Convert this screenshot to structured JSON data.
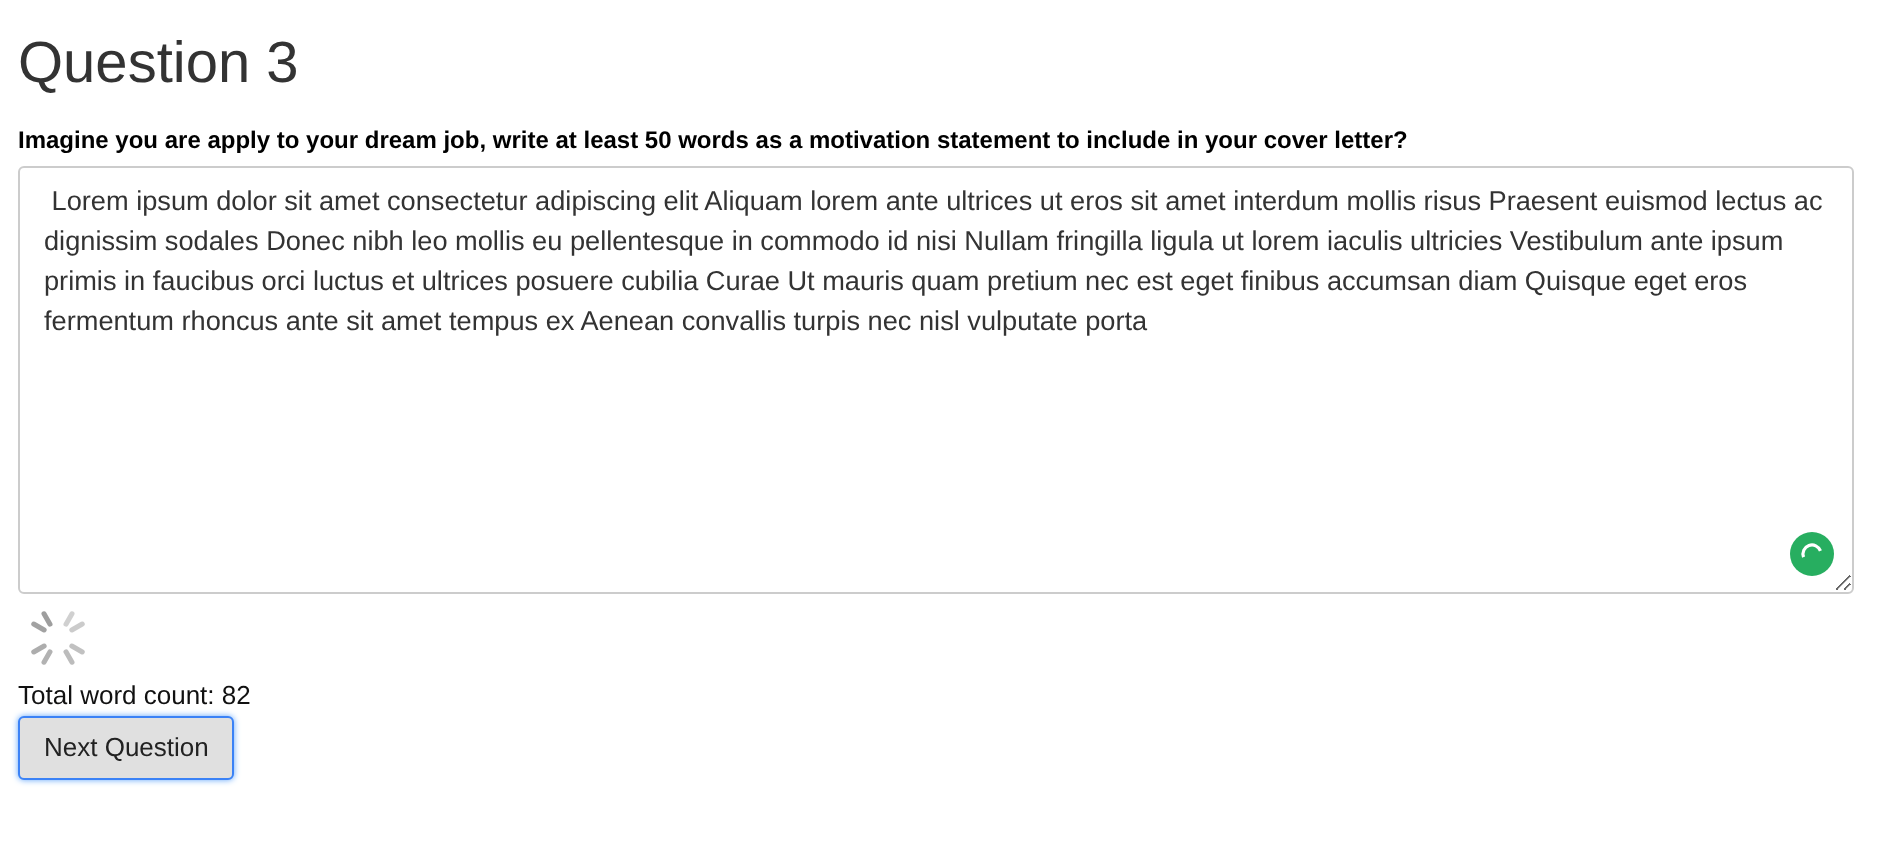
{
  "heading": "Question 3",
  "prompt": "Imagine you are apply to your dream job, write at least 50 words as a motivation statement to include in your cover letter?",
  "answer": {
    "value": " Lorem ipsum dolor sit amet consectetur adipiscing elit Aliquam lorem ante ultrices ut eros sit amet interdum mollis risus Praesent euismod lectus ac dignissim sodales Donec nibh leo mollis eu pellentesque in commodo id nisi Nullam fringilla ligula ut lorem iaculis ultricies Vestibulum ante ipsum primis in faucibus orci luctus et ultrices posuere cubilia Curae Ut mauris quam pretium nec est eget finibus accumsan diam Quisque eget eros fermentum rhoncus ante sit amet tempus ex Aenean convallis turpis nec nisl vulputate porta"
  },
  "loading": true,
  "word_count": "Total word count: 82",
  "next_button": {
    "label": "Next Question",
    "focused": true
  }
}
